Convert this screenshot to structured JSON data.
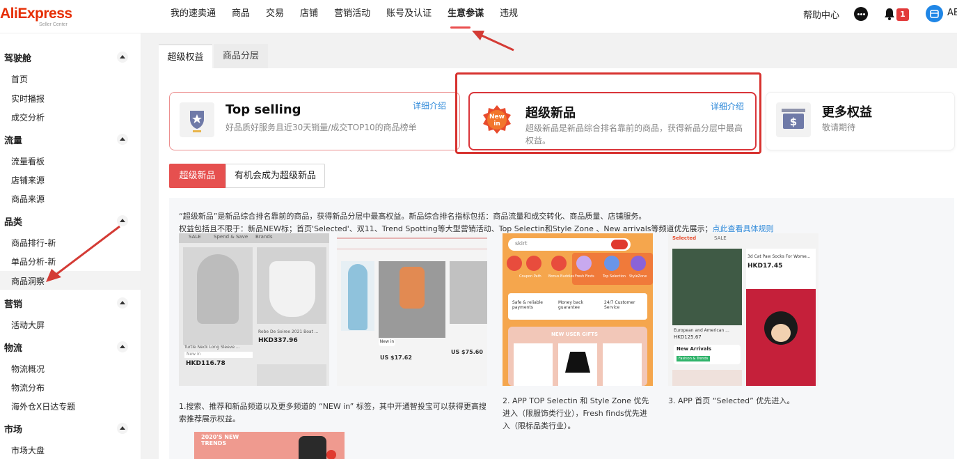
{
  "logo": {
    "brand": "AliExpress",
    "sub": "Seller Center"
  },
  "topnav": {
    "items": [
      "我的速卖通",
      "商品",
      "交易",
      "店铺",
      "营销活动",
      "账号及认证",
      "生意参谋",
      "违规"
    ],
    "active_index": 6
  },
  "topright": {
    "help": "帮助中心",
    "badge": "1",
    "user": "AE"
  },
  "sidebar": {
    "groups": [
      {
        "title": "驾驶舱",
        "items": [
          "首页",
          "实时播报",
          "成交分析"
        ]
      },
      {
        "title": "流量",
        "items": [
          "流量看板",
          "店铺来源",
          "商品来源"
        ]
      },
      {
        "title": "品类",
        "items": [
          "商品排行-新",
          "单品分析-新",
          "商品洞察"
        ]
      },
      {
        "title": "营销",
        "items": [
          "活动大屏"
        ]
      },
      {
        "title": "物流",
        "items": [
          "物流概况",
          "物流分布",
          "海外仓X日达专题"
        ]
      },
      {
        "title": "市场",
        "items": [
          "市场大盘"
        ]
      }
    ],
    "active_item": "商品洞察"
  },
  "tabs": [
    "超级权益",
    "商品分层"
  ],
  "cards": [
    {
      "title": "Top selling",
      "desc": "好品质好服务且近30天销量/成交TOP10的商品榜单",
      "more": "详细介绍",
      "icon": "trophy-icon"
    },
    {
      "title": "超级新品",
      "desc": "超级新品是新品综合排名靠前的商品，获得新品分层中最高权益。",
      "more": "详细介绍",
      "icon": "new-in-badge-icon",
      "badge_text": "New in"
    },
    {
      "title": "更多权益",
      "desc": "敬请期待",
      "icon": "dollar-box-icon"
    }
  ],
  "segments": [
    "超级新品",
    "有机会成为超级新品"
  ],
  "info": {
    "line1": "“超级新品”是新品综合排名靠前的商品，获得新品分层中最高权益。新品综合排名指标包括：商品流量和成交转化、商品质量、店铺服务。",
    "line2": "权益包括且不限于：新品NEW标；首页'Selected'、双11、Trend Spotting等大型营销活动、Top Selectin和Style Zone 、New arrivals等频道优先展示；",
    "line2_link": "点此查看具体规则",
    "captions": [
      "1.搜索、推荐和新品频道以及更多频道的 “NEW in” 标签，其中开通智投宝可以获得更高搜索推荐展示权益。",
      "2. APP TOP Selectin 和 Style Zone 优先进入（限服饰类行业），Fresh finds优先进入（限标品类行业）。",
      "3. APP 首页 “Selected” 优先进入。"
    ],
    "shot1": {
      "tabs": [
        "SALE",
        "Spend & Save",
        "Brands"
      ],
      "price1": "HKD337.96",
      "price2": "HKD116.78",
      "tag": "New in",
      "title1": "Robe De Soiree 2021 Boat ...",
      "title2": "Turtle Neck Long Sleeve ..."
    },
    "shot2": {
      "price": "US $17.62",
      "price2": "US $75.60",
      "tag": "New in"
    },
    "shot3": {
      "search": "skirt",
      "cats": [
        "Coupon Path",
        "Bonus Buddies",
        "Fresh Finds",
        "Top Selection",
        "StyleZone"
      ],
      "service1": "Safe & reliable payments",
      "service2": "Money back guarantee",
      "service3": "24/7 Customer Service",
      "banner": "NEW USER GIFTS"
    },
    "shot4": {
      "tabs": [
        "Selected",
        "SALE"
      ],
      "price": "HKD17.45",
      "price2": "HKD125.67",
      "title": "3d Cat Paw Socks For Wome...",
      "title2": "European and American ...",
      "badge": "New Arrivals",
      "badge_sub": "Fashion & Trends"
    },
    "shot5": {
      "title": "2020'S NEW TRENDS"
    }
  },
  "colors": {
    "accent": "#e6504f",
    "link": "#2c88d9",
    "annotation": "#d7322f"
  }
}
